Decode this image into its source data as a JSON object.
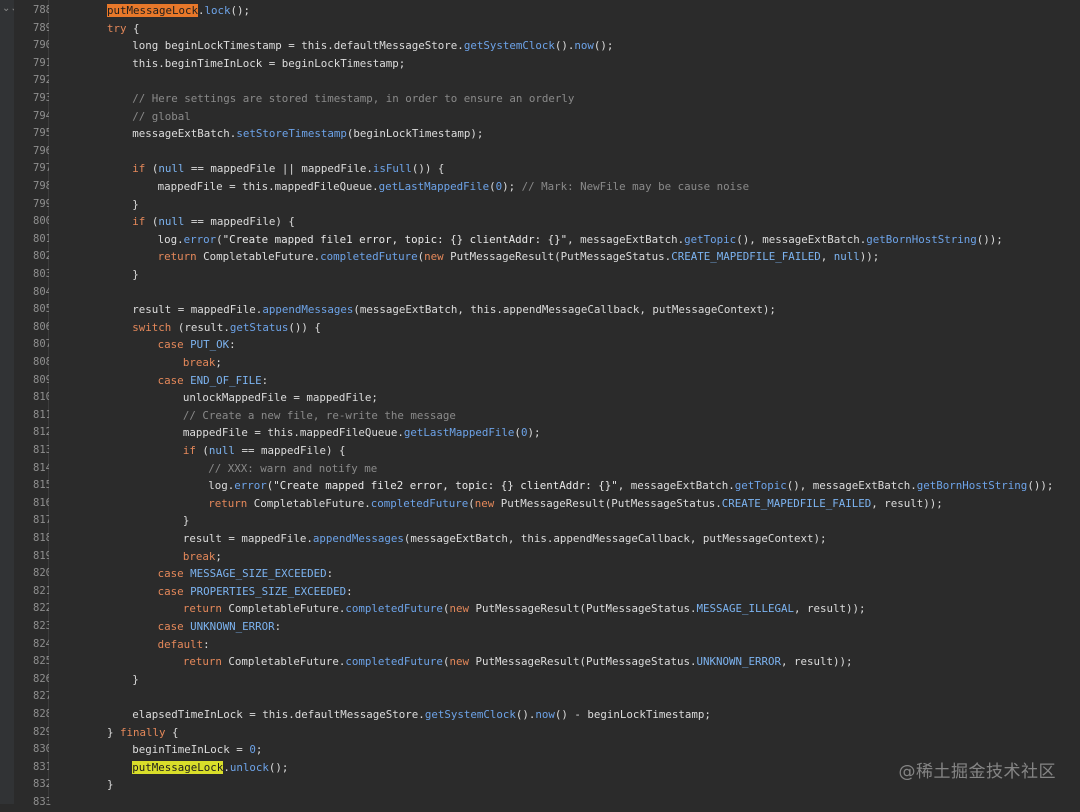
{
  "editor": {
    "fold_marker": "⌄⌄",
    "watermark": "@稀土掘金技术社区",
    "colors": {
      "background": "#2b2b2b",
      "keyword": "#e4885a",
      "method": "#6da3e8",
      "constant": "#7cb3f0",
      "comment": "#8a8a8a",
      "highlight_write": "#e8782a",
      "highlight_read": "#d9de2a"
    }
  },
  "lines": [
    {
      "n": "788",
      "i": 2,
      "t": [
        [
          "putMessageLock",
          "hl1"
        ],
        [
          ".",
          ""
        ],
        [
          "lock",
          "fn"
        ],
        [
          "();",
          ""
        ]
      ]
    },
    {
      "n": "789",
      "i": 2,
      "t": [
        [
          "try",
          "kw"
        ],
        [
          " {",
          ""
        ]
      ]
    },
    {
      "n": "790",
      "i": 3,
      "t": [
        [
          "long beginLockTimestamp = this.defaultMessageStore.",
          ""
        ],
        [
          "getSystemClock",
          "fn"
        ],
        [
          "().",
          ""
        ],
        [
          "now",
          "fn"
        ],
        [
          "();",
          ""
        ]
      ]
    },
    {
      "n": "791",
      "i": 3,
      "t": [
        [
          "this.beginTimeInLock = beginLockTimestamp;",
          ""
        ]
      ]
    },
    {
      "n": "792",
      "i": 0,
      "t": []
    },
    {
      "n": "793",
      "i": 3,
      "t": [
        [
          "// Here settings are stored timestamp, in order to ensure an orderly",
          "cm"
        ]
      ]
    },
    {
      "n": "794",
      "i": 3,
      "t": [
        [
          "// global",
          "cm"
        ]
      ]
    },
    {
      "n": "795",
      "i": 3,
      "t": [
        [
          "messageExtBatch.",
          ""
        ],
        [
          "setStoreTimestamp",
          "fn"
        ],
        [
          "(beginLockTimestamp);",
          ""
        ]
      ]
    },
    {
      "n": "796",
      "i": 0,
      "t": []
    },
    {
      "n": "797",
      "i": 3,
      "t": [
        [
          "if",
          "kw"
        ],
        [
          " (",
          ""
        ],
        [
          "null",
          "null"
        ],
        [
          " == mappedFile || mappedFile.",
          ""
        ],
        [
          "isFull",
          "fn"
        ],
        [
          "()) {",
          ""
        ]
      ]
    },
    {
      "n": "798",
      "i": 4,
      "t": [
        [
          "mappedFile = this.mappedFileQueue.",
          ""
        ],
        [
          "getLastMappedFile",
          "fn"
        ],
        [
          "(",
          ""
        ],
        [
          "0",
          "num"
        ],
        [
          "); ",
          ""
        ],
        [
          "// Mark: NewFile may be cause noise",
          "cm"
        ]
      ]
    },
    {
      "n": "799",
      "i": 3,
      "t": [
        [
          "}",
          ""
        ]
      ]
    },
    {
      "n": "800",
      "i": 3,
      "t": [
        [
          "if",
          "kw"
        ],
        [
          " (",
          ""
        ],
        [
          "null",
          "null"
        ],
        [
          " == mappedFile) {",
          ""
        ]
      ]
    },
    {
      "n": "801",
      "i": 4,
      "t": [
        [
          "log.",
          ""
        ],
        [
          "error",
          "fn"
        ],
        [
          "(",
          ""
        ],
        [
          "\"Create mapped file1 error, topic: {} clientAddr: {}\"",
          "str"
        ],
        [
          ", messageExtBatch.",
          ""
        ],
        [
          "getTopic",
          "fn"
        ],
        [
          "(), messageExtBatch.",
          ""
        ],
        [
          "getBornHostString",
          "fn"
        ],
        [
          "());",
          ""
        ]
      ]
    },
    {
      "n": "802",
      "i": 4,
      "t": [
        [
          "return",
          "kw"
        ],
        [
          " CompletableFuture.",
          ""
        ],
        [
          "completedFuture",
          "fn"
        ],
        [
          "(",
          ""
        ],
        [
          "new",
          "kw"
        ],
        [
          " PutMessageResult(PutMessageStatus.",
          ""
        ],
        [
          "CREATE_MAPEDFILE_FAILED",
          "cn"
        ],
        [
          ", ",
          ""
        ],
        [
          "null",
          "null"
        ],
        [
          "));",
          ""
        ]
      ]
    },
    {
      "n": "803",
      "i": 3,
      "t": [
        [
          "}",
          ""
        ]
      ]
    },
    {
      "n": "804",
      "i": 0,
      "t": []
    },
    {
      "n": "805",
      "i": 3,
      "t": [
        [
          "result = mappedFile.",
          ""
        ],
        [
          "appendMessages",
          "fn"
        ],
        [
          "(messageExtBatch, this.appendMessageCallback, putMessageContext);",
          ""
        ]
      ]
    },
    {
      "n": "806",
      "i": 3,
      "t": [
        [
          "switch",
          "kw"
        ],
        [
          " (result.",
          ""
        ],
        [
          "getStatus",
          "fn"
        ],
        [
          "()) {",
          ""
        ]
      ]
    },
    {
      "n": "807",
      "i": 4,
      "t": [
        [
          "case",
          "kw"
        ],
        [
          " ",
          ""
        ],
        [
          "PUT_OK",
          "cn"
        ],
        [
          ":",
          ""
        ]
      ]
    },
    {
      "n": "808",
      "i": 5,
      "t": [
        [
          "break",
          "kw"
        ],
        [
          ";",
          ""
        ]
      ]
    },
    {
      "n": "809",
      "i": 4,
      "t": [
        [
          "case",
          "kw"
        ],
        [
          " ",
          ""
        ],
        [
          "END_OF_FILE",
          "cn"
        ],
        [
          ":",
          ""
        ]
      ]
    },
    {
      "n": "810",
      "i": 5,
      "t": [
        [
          "unlockMappedFile = mappedFile;",
          ""
        ]
      ]
    },
    {
      "n": "811",
      "i": 5,
      "t": [
        [
          "// Create a new file, re-write the message",
          "cm"
        ]
      ]
    },
    {
      "n": "812",
      "i": 5,
      "t": [
        [
          "mappedFile = this.mappedFileQueue.",
          ""
        ],
        [
          "getLastMappedFile",
          "fn"
        ],
        [
          "(",
          ""
        ],
        [
          "0",
          "num"
        ],
        [
          ");",
          ""
        ]
      ]
    },
    {
      "n": "813",
      "i": 5,
      "t": [
        [
          "if",
          "kw"
        ],
        [
          " (",
          ""
        ],
        [
          "null",
          "null"
        ],
        [
          " == mappedFile) {",
          ""
        ]
      ]
    },
    {
      "n": "814",
      "i": 6,
      "t": [
        [
          "// XXX: warn and notify me",
          "cm"
        ]
      ]
    },
    {
      "n": "815",
      "i": 6,
      "t": [
        [
          "log.",
          ""
        ],
        [
          "error",
          "fn"
        ],
        [
          "(",
          ""
        ],
        [
          "\"Create mapped file2 error, topic: {} clientAddr: {}\"",
          "str"
        ],
        [
          ", messageExtBatch.",
          ""
        ],
        [
          "getTopic",
          "fn"
        ],
        [
          "(), messageExtBatch.",
          ""
        ],
        [
          "getBornHostString",
          "fn"
        ],
        [
          "());",
          ""
        ]
      ]
    },
    {
      "n": "816",
      "i": 6,
      "t": [
        [
          "return",
          "kw"
        ],
        [
          " CompletableFuture.",
          ""
        ],
        [
          "completedFuture",
          "fn"
        ],
        [
          "(",
          ""
        ],
        [
          "new",
          "kw"
        ],
        [
          " PutMessageResult(PutMessageStatus.",
          ""
        ],
        [
          "CREATE_MAPEDFILE_FAILED",
          "cn"
        ],
        [
          ", result));",
          ""
        ]
      ]
    },
    {
      "n": "817",
      "i": 5,
      "t": [
        [
          "}",
          ""
        ]
      ]
    },
    {
      "n": "818",
      "i": 5,
      "t": [
        [
          "result = mappedFile.",
          ""
        ],
        [
          "appendMessages",
          "fn"
        ],
        [
          "(messageExtBatch, this.appendMessageCallback, putMessageContext);",
          ""
        ]
      ]
    },
    {
      "n": "819",
      "i": 5,
      "t": [
        [
          "break",
          "kw"
        ],
        [
          ";",
          ""
        ]
      ]
    },
    {
      "n": "820",
      "i": 4,
      "t": [
        [
          "case",
          "kw"
        ],
        [
          " ",
          ""
        ],
        [
          "MESSAGE_SIZE_EXCEEDED",
          "cn"
        ],
        [
          ":",
          ""
        ]
      ]
    },
    {
      "n": "821",
      "i": 4,
      "t": [
        [
          "case",
          "kw"
        ],
        [
          " ",
          ""
        ],
        [
          "PROPERTIES_SIZE_EXCEEDED",
          "cn"
        ],
        [
          ":",
          ""
        ]
      ]
    },
    {
      "n": "822",
      "i": 5,
      "t": [
        [
          "return",
          "kw"
        ],
        [
          " CompletableFuture.",
          ""
        ],
        [
          "completedFuture",
          "fn"
        ],
        [
          "(",
          ""
        ],
        [
          "new",
          "kw"
        ],
        [
          " PutMessageResult(PutMessageStatus.",
          ""
        ],
        [
          "MESSAGE_ILLEGAL",
          "cn"
        ],
        [
          ", result));",
          ""
        ]
      ]
    },
    {
      "n": "823",
      "i": 4,
      "t": [
        [
          "case",
          "kw"
        ],
        [
          " ",
          ""
        ],
        [
          "UNKNOWN_ERROR",
          "cn"
        ],
        [
          ":",
          ""
        ]
      ]
    },
    {
      "n": "824",
      "i": 4,
      "t": [
        [
          "default",
          "kw"
        ],
        [
          ":",
          ""
        ]
      ]
    },
    {
      "n": "825",
      "i": 5,
      "t": [
        [
          "return",
          "kw"
        ],
        [
          " CompletableFuture.",
          ""
        ],
        [
          "completedFuture",
          "fn"
        ],
        [
          "(",
          ""
        ],
        [
          "new",
          "kw"
        ],
        [
          " PutMessageResult(PutMessageStatus.",
          ""
        ],
        [
          "UNKNOWN_ERROR",
          "cn"
        ],
        [
          ", result));",
          ""
        ]
      ]
    },
    {
      "n": "826",
      "i": 3,
      "t": [
        [
          "}",
          ""
        ]
      ]
    },
    {
      "n": "827",
      "i": 0,
      "t": []
    },
    {
      "n": "828",
      "i": 3,
      "t": [
        [
          "elapsedTimeInLock = this.defaultMessageStore.",
          ""
        ],
        [
          "getSystemClock",
          "fn"
        ],
        [
          "().",
          ""
        ],
        [
          "now",
          "fn"
        ],
        [
          "() - beginLockTimestamp;",
          ""
        ]
      ]
    },
    {
      "n": "829",
      "i": 2,
      "t": [
        [
          "} ",
          ""
        ],
        [
          "finally",
          "kw"
        ],
        [
          " {",
          ""
        ]
      ]
    },
    {
      "n": "830",
      "i": 3,
      "t": [
        [
          "beginTimeInLock = ",
          ""
        ],
        [
          "0",
          "num"
        ],
        [
          ";",
          ""
        ]
      ]
    },
    {
      "n": "831",
      "i": 3,
      "t": [
        [
          "putMessageLock",
          "hl2"
        ],
        [
          ".",
          ""
        ],
        [
          "unlock",
          "fn"
        ],
        [
          "();",
          ""
        ]
      ]
    },
    {
      "n": "832",
      "i": 2,
      "t": [
        [
          "}",
          ""
        ]
      ]
    },
    {
      "n": "833",
      "i": 0,
      "t": []
    }
  ]
}
